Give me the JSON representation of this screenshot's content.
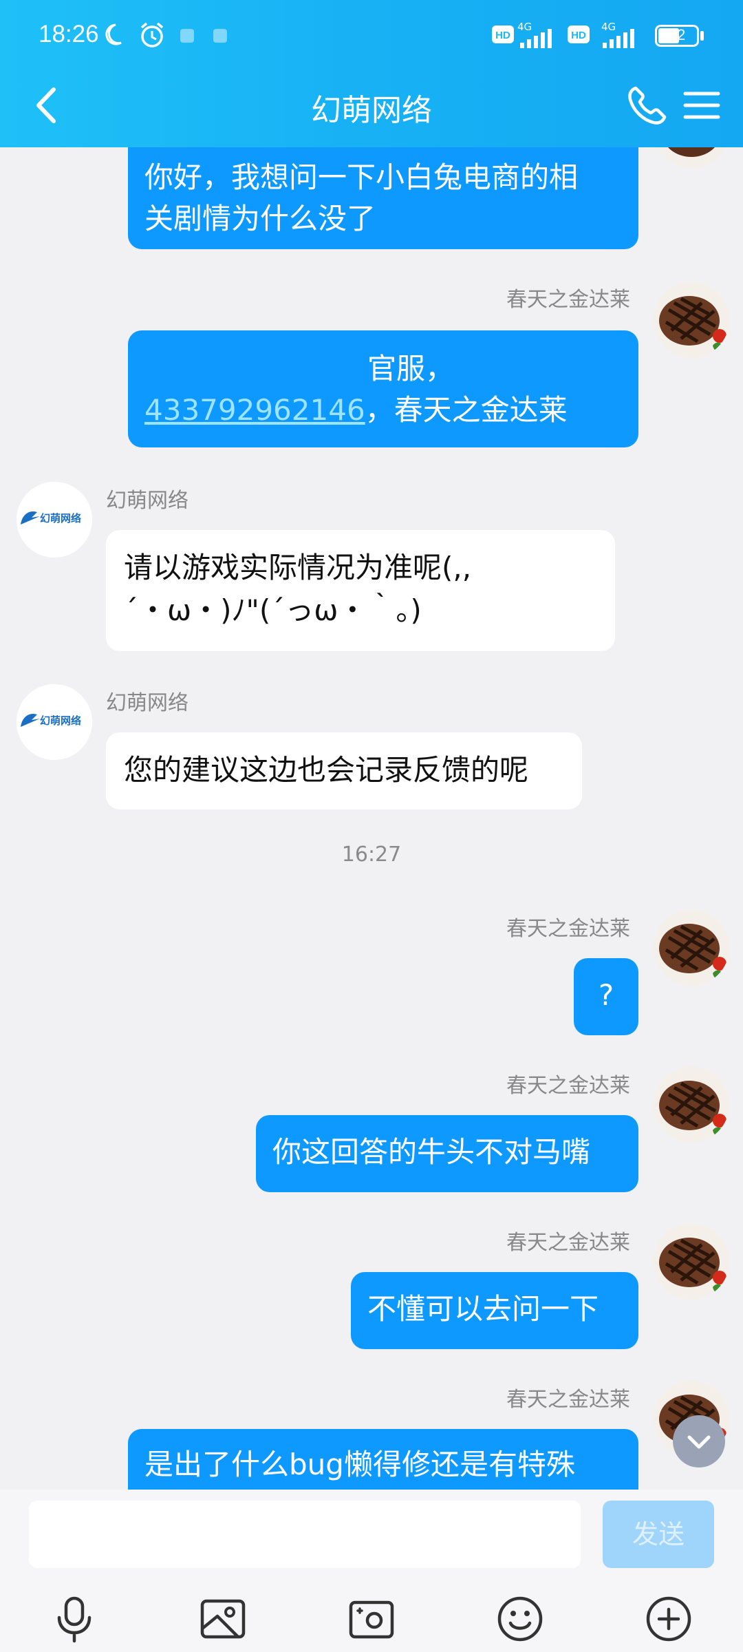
{
  "status_bar": {
    "time": "18:26",
    "battery": "52",
    "network_1": "4G",
    "network_2": "4G"
  },
  "header": {
    "title": "幻萌网络"
  },
  "messages": {
    "m1": {
      "lines": [
        "你好，我想问一下小白兔电商的相",
        "关剧情为什么没了"
      ]
    },
    "m2": {
      "sender": "春天之金达莱",
      "line1": "官服，",
      "link": "433792962146",
      "line2_rest": "，春天之金达莱"
    },
    "m3": {
      "sender": "幻萌网络",
      "lines": [
        "请以游戏实际情况为准呢(,,",
        "´・ω・)ﾉ\"(´っω・｀。)"
      ]
    },
    "m4": {
      "sender": "幻萌网络",
      "text": "您的建议这边也会记录反馈的呢"
    },
    "timestamp": "16:27",
    "m5": {
      "sender": "春天之金达莱",
      "text": "?"
    },
    "m6": {
      "sender": "春天之金达莱",
      "text": "你这回答的牛头不对马嘴"
    },
    "m7": {
      "sender": "春天之金达莱",
      "text": "不懂可以去问一下"
    },
    "m8": {
      "sender": "春天之金达莱",
      "text": "是出了什么bug懒得修还是有特殊"
    }
  },
  "avatars": {
    "company_logo_text": "幻萌网络"
  },
  "input": {
    "placeholder": "",
    "send_label": "发送"
  },
  "colors": {
    "header": "#1cb8f6",
    "my_bubble": "#0d99ff",
    "their_bubble": "#ffffff",
    "background": "#f1f1f3"
  }
}
